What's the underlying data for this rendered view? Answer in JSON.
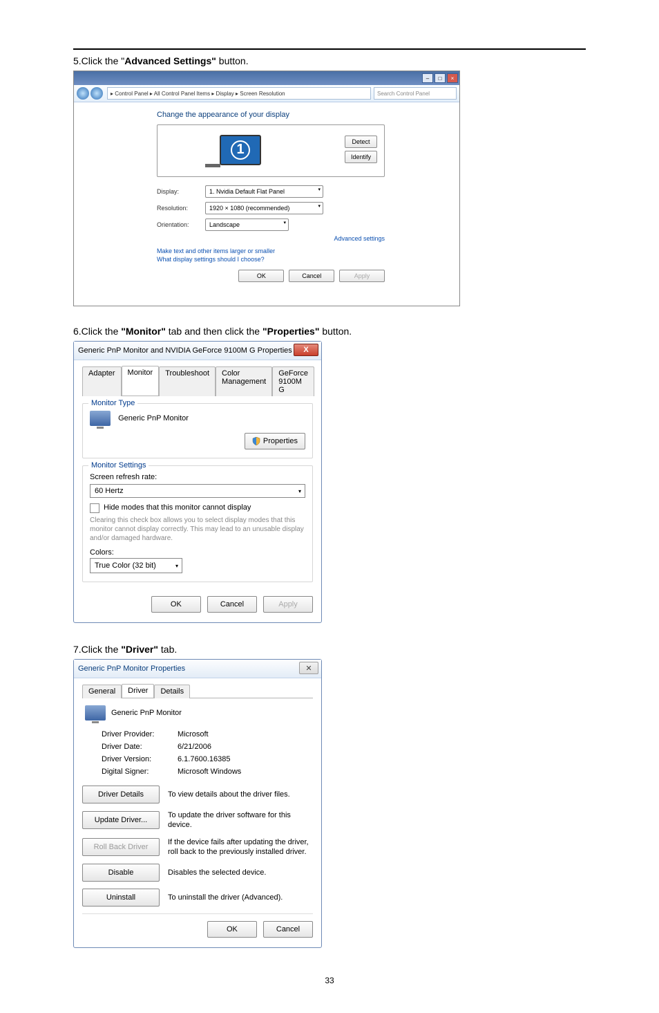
{
  "page_number": "33",
  "steps": {
    "s5_prefix": "5.Click the ",
    "s5_quote_open": "\"",
    "s5_bold": "Advanced Settings\"",
    "s5_suffix": " button.",
    "s6_prefix": "6.Click the ",
    "s6_bold1": "\"Monitor\"",
    "s6_mid": " tab and then click the ",
    "s6_bold2": "\"Properties\"",
    "s6_suffix": " button.",
    "s7_prefix": "7.Click the ",
    "s7_bold": "\"Driver\"",
    "s7_suffix": " tab."
  },
  "screenres": {
    "breadcrumb": "▸ Control Panel ▸ All Control Panel Items ▸ Display ▸ Screen Resolution",
    "search_placeholder": "Search Control Panel",
    "header": "Change the appearance of your display",
    "monitor_num": "1",
    "detect": "Detect",
    "identify": "Identify",
    "display_label": "Display:",
    "display_value": "1. Nvidia Default Flat Panel",
    "resolution_label": "Resolution:",
    "resolution_value": "1920 × 1080 (recommended)",
    "orientation_label": "Orientation:",
    "orientation_value": "Landscape",
    "advanced": "Advanced settings",
    "link1": "Make text and other items larger or smaller",
    "link2": "What display settings should I choose?",
    "ok": "OK",
    "cancel": "Cancel",
    "apply": "Apply"
  },
  "monitor_dialog": {
    "title": "Generic PnP Monitor and NVIDIA GeForce 9100M G   Properties",
    "tabs": {
      "adapter": "Adapter",
      "monitor": "Monitor",
      "troubleshoot": "Troubleshoot",
      "color": "Color Management",
      "gpu": "GeForce 9100M G"
    },
    "group_type": "Monitor Type",
    "monitor_name": "Generic PnP Monitor",
    "properties_btn": "Properties",
    "group_settings": "Monitor Settings",
    "refresh_label": "Screen refresh rate:",
    "refresh_value": "60 Hertz",
    "hide_modes": "Hide modes that this monitor cannot display",
    "helptext": "Clearing this check box allows you to select display modes that this monitor cannot display correctly. This may lead to an unusable display and/or damaged hardware.",
    "colors_label": "Colors:",
    "colors_value": "True Color (32 bit)",
    "ok": "OK",
    "cancel": "Cancel",
    "apply": "Apply"
  },
  "driver_dialog": {
    "title": "Generic PnP Monitor Properties",
    "tabs": {
      "general": "General",
      "driver": "Driver",
      "details": "Details"
    },
    "device_name": "Generic PnP Monitor",
    "rows": {
      "provider_l": "Driver Provider:",
      "provider_v": "Microsoft",
      "date_l": "Driver Date:",
      "date_v": "6/21/2006",
      "version_l": "Driver Version:",
      "version_v": "6.1.7600.16385",
      "signer_l": "Digital Signer:",
      "signer_v": "Microsoft Windows"
    },
    "actions": {
      "details_btn": "Driver Details",
      "details_desc": "To view details about the driver files.",
      "update_btn": "Update Driver...",
      "update_desc": "To update the driver software for this device.",
      "rollback_btn": "Roll Back Driver",
      "rollback_desc": "If the device fails after updating the driver, roll back to the previously installed driver.",
      "disable_btn": "Disable",
      "disable_desc": "Disables the selected device.",
      "uninstall_btn": "Uninstall",
      "uninstall_desc": "To uninstall the driver (Advanced)."
    },
    "ok": "OK",
    "cancel": "Cancel"
  }
}
